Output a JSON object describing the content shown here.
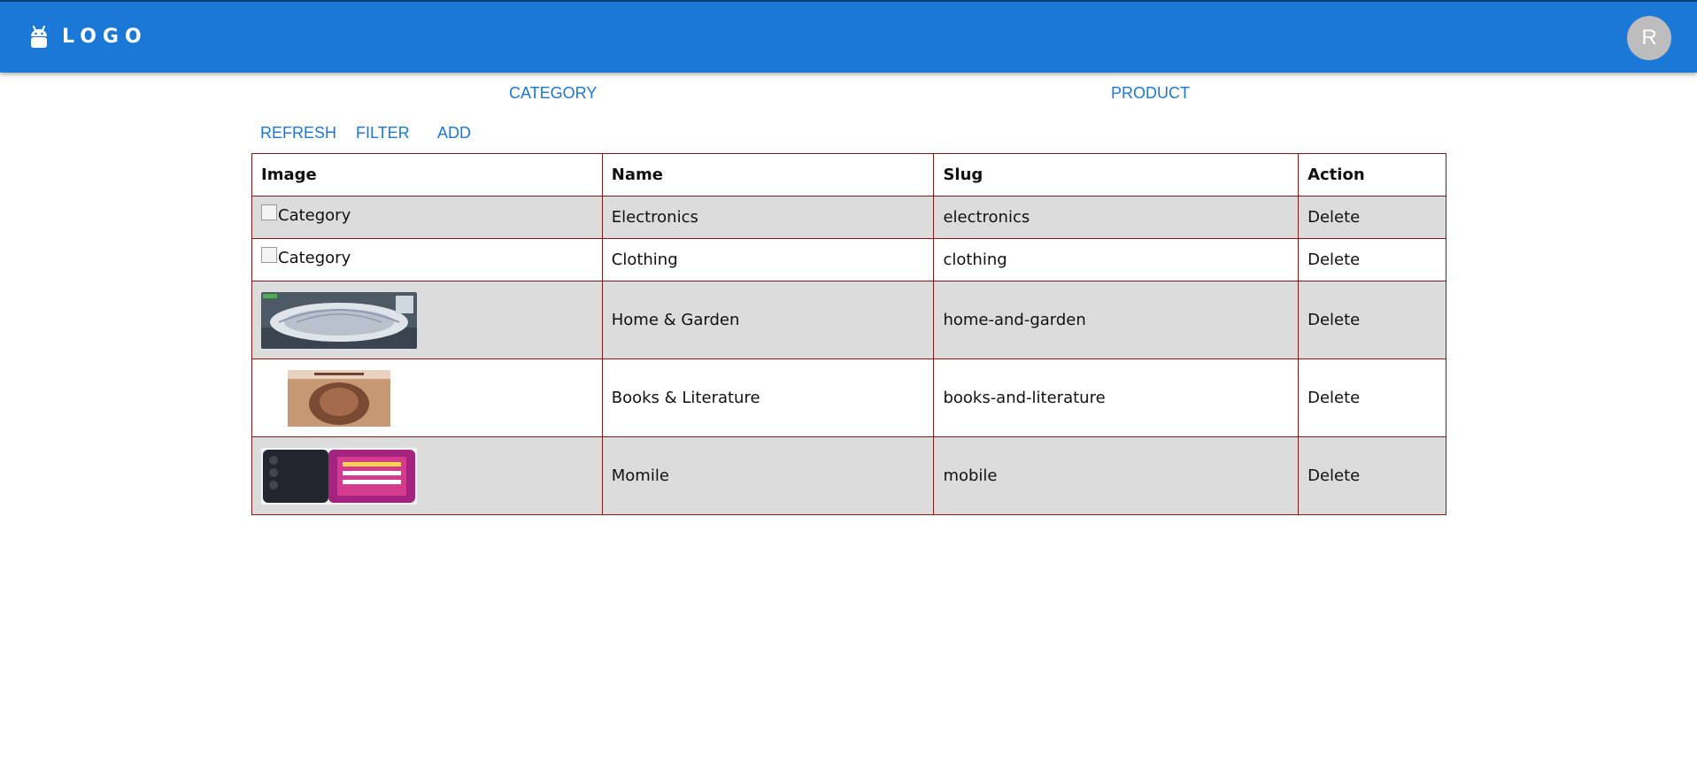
{
  "header": {
    "logo_text": "LOGO",
    "logo_icon": "android-icon",
    "avatar_initial": "R",
    "brand_color": "#1b78d6"
  },
  "nav": {
    "category_label": "CATEGORY",
    "product_label": "PRODUCT"
  },
  "toolbar": {
    "refresh_label": "REFRESH",
    "filter_label": "FILTER",
    "add_label": "ADD"
  },
  "table": {
    "columns": [
      "Image",
      "Name",
      "Slug",
      "Action"
    ],
    "rows": [
      {
        "image_alt": "Category",
        "image_kind": "broken",
        "name": "Electronics",
        "slug": "electronics",
        "action": "Delete"
      },
      {
        "image_alt": "Category",
        "image_kind": "broken",
        "name": "Clothing",
        "slug": "clothing",
        "action": "Delete"
      },
      {
        "image_alt": "",
        "image_kind": "photo-home-garden",
        "name": "Home & Garden",
        "slug": "home-and-garden",
        "action": "Delete"
      },
      {
        "image_alt": "",
        "image_kind": "photo-book-cover",
        "name": "Books & Literature",
        "slug": "books-and-literature",
        "action": "Delete"
      },
      {
        "image_alt": "",
        "image_kind": "photo-mobile-phone",
        "name": "Momile",
        "slug": "mobile",
        "action": "Delete"
      }
    ]
  }
}
